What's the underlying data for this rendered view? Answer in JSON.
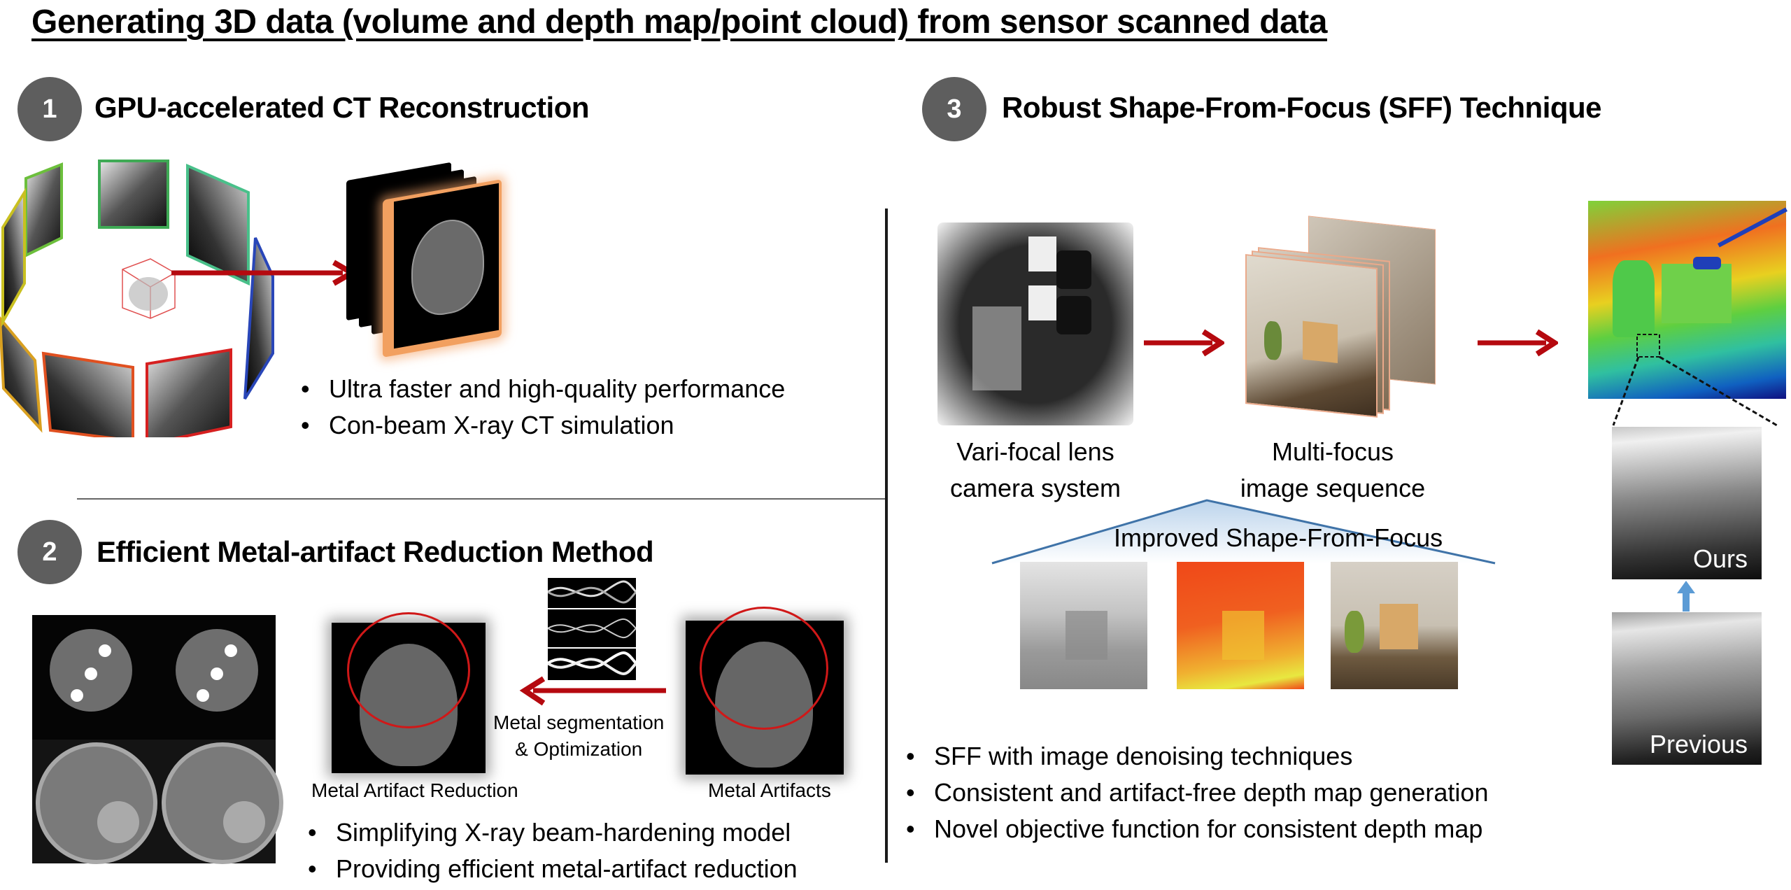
{
  "title": "Generating 3D data (volume and depth map/point cloud) from sensor scanned data",
  "sections": [
    {
      "number": "1",
      "title": "GPU-accelerated CT Reconstruction",
      "bullets": [
        "Ultra faster and high-quality performance",
        "Con-beam X-ray CT simulation"
      ]
    },
    {
      "number": "2",
      "title": "Efficient Metal-artifact Reduction Method",
      "arrow_label_line1": "Metal segmentation",
      "arrow_label_line2": "& Optimization",
      "left_image_caption": "Metal Artifact Reduction",
      "right_image_caption": "Metal Artifacts",
      "bullets": [
        "Simplifying X-ray beam-hardening model",
        "Providing efficient metal-artifact reduction"
      ]
    },
    {
      "number": "3",
      "title": "Robust Shape-From-Focus (SFF) Technique",
      "camera_caption_line1": "Vari-focal lens",
      "camera_caption_line2": "camera system",
      "sequence_caption_line1": "Multi-focus",
      "sequence_caption_line2": "image sequence",
      "improved_label": "Improved Shape-From-Focus",
      "comparison_top_label": "Ours",
      "comparison_bottom_label": "Previous",
      "bullets": [
        "SFF with image denoising techniques",
        "Consistent and artifact-free depth map generation",
        "Novel objective function for consistent depth map"
      ]
    }
  ],
  "colors": {
    "badge": "#5e5e5e",
    "arrow_red": "#b5090f",
    "arrow_blue": "#5b9bd5",
    "roof_line": "#3f73a8",
    "highlight_orange": "#f5a56a"
  }
}
